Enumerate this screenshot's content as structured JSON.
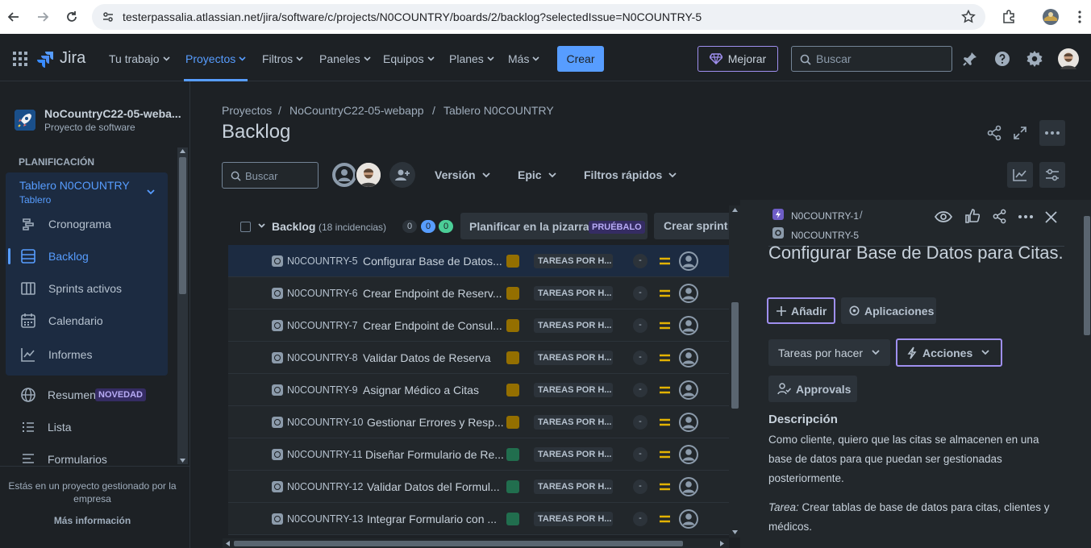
{
  "browser": {
    "url": "testerpassalia.atlassian.net/jira/software/c/projects/N0COUNTRY/boards/2/backlog?selectedIssue=N0COUNTRY-5"
  },
  "topnav": {
    "product": "Jira",
    "items": [
      "Tu trabajo",
      "Proyectos",
      "Filtros",
      "Paneles",
      "Equipos",
      "Planes",
      "Más"
    ],
    "create_label": "Crear",
    "upgrade_label": "Mejorar",
    "search_placeholder": "Buscar",
    "active_item": "Proyectos"
  },
  "sidebar": {
    "project_name": "NoCountryC22-05-weba...",
    "project_type": "Proyecto de software",
    "section_planning": "PLANIFICACIÓN",
    "board_name": "Tablero N0COUNTRY",
    "board_sub": "Tablero",
    "items": [
      {
        "label": "Cronograma",
        "icon": "timeline-icon"
      },
      {
        "label": "Backlog",
        "icon": "backlog-icon"
      },
      {
        "label": "Sprints activos",
        "icon": "sprints-icon"
      },
      {
        "label": "Calendario",
        "icon": "calendar-icon"
      },
      {
        "label": "Informes",
        "icon": "reports-icon"
      }
    ],
    "summary_label": "Resumen",
    "summary_badge": "NOVEDAD",
    "list_label": "Lista",
    "forms_label": "Formularios",
    "footer_text": "Estás en un proyecto gestionado por la empresa",
    "footer_link": "Más información"
  },
  "main": {
    "breadcrumbs": [
      "Proyectos",
      "NoCountryC22-05-webapp",
      "Tablero N0COUNTRY"
    ],
    "title": "Backlog",
    "search_placeholder": "Buscar",
    "filter_version": "Versión",
    "filter_epic": "Epic",
    "filter_quick": "Filtros rápidos",
    "backlog_header": {
      "label": "Backlog",
      "count": "(18 incidencias)",
      "badge_grey": "0",
      "badge_blue": "0",
      "badge_green": "0",
      "plan_label": "Planificar en la pizarra",
      "try_label": "PRUÉBALO",
      "create_sprint": "Crear sprint"
    },
    "issues": [
      {
        "key": "N0COUNTRY-5",
        "summary": "Configurar Base de Datos...",
        "epic_color": "#946f00",
        "status": "TAREAS POR H...",
        "estimate": "-",
        "selected": true
      },
      {
        "key": "N0COUNTRY-6",
        "summary": "Crear Endpoint de Reserv...",
        "epic_color": "#946f00",
        "status": "TAREAS POR H...",
        "estimate": "-"
      },
      {
        "key": "N0COUNTRY-7",
        "summary": "Crear Endpoint de Consul...",
        "epic_color": "#946f00",
        "status": "TAREAS POR H...",
        "estimate": "-"
      },
      {
        "key": "N0COUNTRY-8",
        "summary": "Validar Datos de Reserva",
        "epic_color": "#946f00",
        "status": "TAREAS POR H...",
        "estimate": "-"
      },
      {
        "key": "N0COUNTRY-9",
        "summary": "Asignar Médico a Citas",
        "epic_color": "#946f00",
        "status": "TAREAS POR H...",
        "estimate": "-"
      },
      {
        "key": "N0COUNTRY-10",
        "summary": "Gestionar Errores y Resp...",
        "epic_color": "#946f00",
        "status": "TAREAS POR H...",
        "estimate": "-"
      },
      {
        "key": "N0COUNTRY-11",
        "summary": "Diseñar Formulario de Re...",
        "epic_color": "#216e4e",
        "status": "TAREAS POR H...",
        "estimate": "-"
      },
      {
        "key": "N0COUNTRY-12",
        "summary": "Validar Datos del Formul...",
        "epic_color": "#216e4e",
        "status": "TAREAS POR H...",
        "estimate": "-"
      },
      {
        "key": "N0COUNTRY-13",
        "summary": "Integrar Formulario con ...",
        "epic_color": "#216e4e",
        "status": "TAREAS POR H...",
        "estimate": "-"
      }
    ]
  },
  "detail": {
    "parent_key": "N0COUNTRY-1",
    "issue_key": "N0COUNTRY-5",
    "title": "Configurar Base de Datos para Citas.",
    "add_label": "Añadir",
    "apps_label": "Aplicaciones",
    "status_label": "Tareas por hacer",
    "actions_label": "Acciones",
    "approvals_label": "Approvals",
    "description_heading": "Descripción",
    "description_text": "Como cliente, quiero que las citas se almacenen en una base de datos para que puedan ser gestionadas posteriormente.",
    "task_label": "Tarea:",
    "task_text": " Crear tablas de base de datos para citas, clientes y médicos."
  },
  "colors": {
    "accent": "#579dff",
    "background": "#1d2125",
    "surface": "#22272b",
    "priority_medium": "#e2b203",
    "epic_yellow": "#946f00",
    "epic_green": "#216e4e",
    "upgrade_purple": "#9f8fef"
  }
}
